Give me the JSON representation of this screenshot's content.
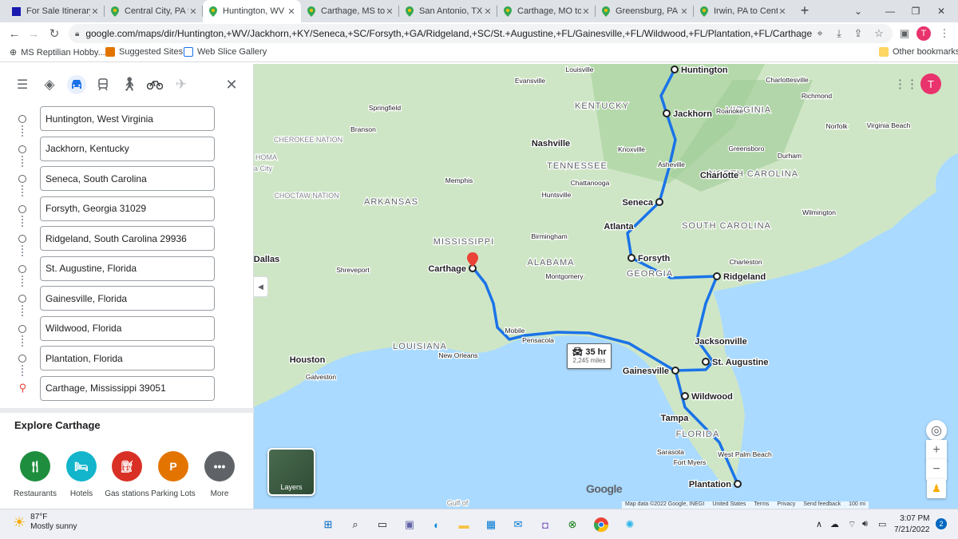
{
  "tabs": [
    {
      "title": "For Sale Itinerary",
      "icon": "blue-square-icon"
    },
    {
      "title": "Central City, PA to",
      "icon": "maps-pin-icon"
    },
    {
      "title": "Huntington, WV to",
      "icon": "maps-pin-icon",
      "active": true
    },
    {
      "title": "Carthage, MS to",
      "icon": "maps-pin-icon"
    },
    {
      "title": "San Antonio, TX to",
      "icon": "maps-pin-icon"
    },
    {
      "title": "Carthage, MO to",
      "icon": "maps-pin-icon"
    },
    {
      "title": "Greensburg, PA to",
      "icon": "maps-pin-icon"
    },
    {
      "title": "Irwin, PA to Centr",
      "icon": "maps-pin-icon"
    }
  ],
  "address": "google.com/maps/dir/Huntington,+WV/Jackhorn,+KY/Seneca,+SC/Forsyth,+GA/Ridgeland,+SC/St.+Augustine,+FL/Gainesville,+FL/Wildwood,+FL/Plantation,+FL/Carthage,+MS/@32.19...",
  "profile_initial": "T",
  "bookmarks": [
    {
      "label": "MS Reptilian Hobby..."
    },
    {
      "label": "Suggested Sites"
    },
    {
      "label": "Web Slice Gallery"
    }
  ],
  "other_bookmarks": "Other bookmarks",
  "stops": [
    {
      "value": "Huntington, West Virginia"
    },
    {
      "value": "Jackhorn, Kentucky"
    },
    {
      "value": "Seneca, South Carolina"
    },
    {
      "value": "Forsyth, Georgia 31029"
    },
    {
      "value": "Ridgeland, South Carolina 29936"
    },
    {
      "value": "St. Augustine, Florida"
    },
    {
      "value": "Gainesville, Florida"
    },
    {
      "value": "Wildwood, Florida"
    },
    {
      "value": "Plantation, Florida"
    },
    {
      "value": "Carthage, Mississippi 39051"
    }
  ],
  "explore": {
    "title": "Explore Carthage",
    "categories": [
      {
        "label": "Restaurants",
        "color": "#1e8e3e"
      },
      {
        "label": "Hotels",
        "color": "#12b5cb"
      },
      {
        "label": "Gas stations",
        "color": "#d93025"
      },
      {
        "label": "Parking Lots",
        "color": "#e37400"
      },
      {
        "label": "More",
        "color": "#5f6368"
      }
    ]
  },
  "map": {
    "route_color": "#1a73e8",
    "route_time": "35 hr",
    "route_distance": "2,245 miles",
    "layers_label": "Layers",
    "logo": "Google",
    "stop_labels": [
      "Huntington",
      "Jackhorn",
      "Seneca",
      "Forsyth",
      "Ridgeland",
      "St. Augustine",
      "Gainesville",
      "Wildwood",
      "Plantation",
      "Carthage"
    ],
    "states": [
      "KENTUCKY",
      "VIRGINIA",
      "TENNESSEE",
      "NORTH CAROLINA",
      "SOUTH CAROLINA",
      "ARKANSAS",
      "MISSISSIPPI",
      "ALABAMA",
      "GEORGIA",
      "LOUISIANA",
      "FLORIDA"
    ],
    "cities": [
      "Louisville",
      "Evansville",
      "Charlottesville",
      "Richmond",
      "Springfield",
      "Roanoke",
      "Norfolk",
      "Virginia Beach",
      "Branson",
      "Nashville",
      "Knoxville",
      "Greensboro",
      "Durham",
      "Asheville",
      "Charlotte",
      "Memphis",
      "Huntsville",
      "Chattanooga",
      "Wilmington",
      "Atlanta",
      "Birmingham",
      "Charleston",
      "Dallas",
      "Shreveport",
      "Montgomery",
      "Mobile",
      "Pensacola",
      "Jacksonville",
      "New Orleans",
      "Houston",
      "Galveston",
      "Tampa",
      "Sarasota",
      "Fort Myers",
      "West Palm Beach"
    ],
    "faded_labels": [
      "HOMA",
      "a City",
      "CHEROKEE NATION",
      "CHOCTAW NATION",
      "Gulf of"
    ],
    "attribution": [
      "Map data ©2022 Google, INEGI",
      "United States",
      "Terms",
      "Privacy",
      "Send feedback",
      "100 mi"
    ]
  },
  "taskbar": {
    "temp": "87°F",
    "weather": "Mostly sunny",
    "time": "3:07 PM",
    "date": "7/21/2022",
    "notifications": "2"
  }
}
